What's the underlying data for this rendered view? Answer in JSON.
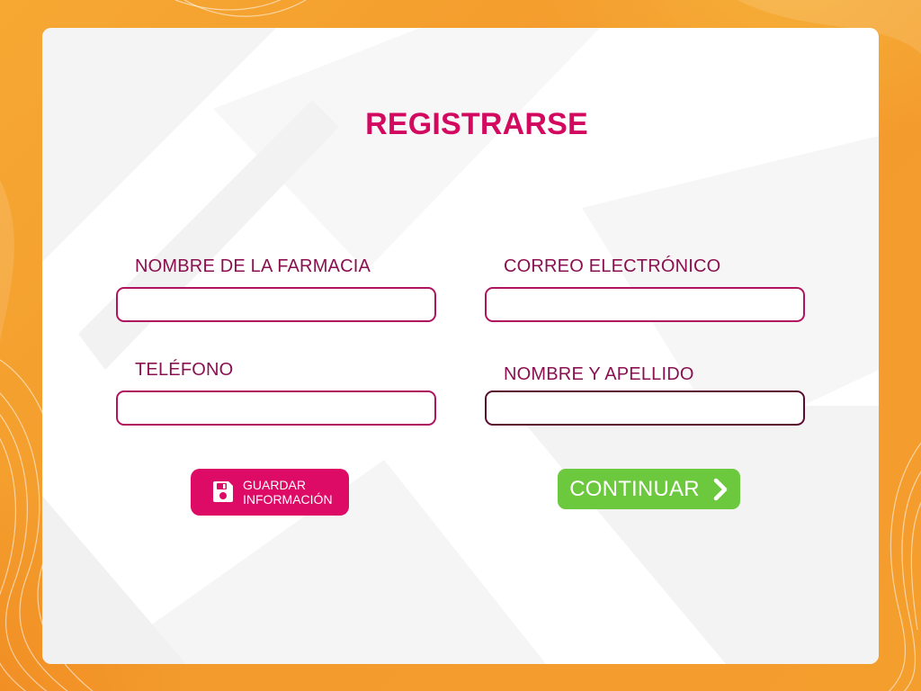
{
  "page": {
    "title": "REGISTRARSE"
  },
  "form": {
    "pharmacy_name": {
      "label": "NOMBRE DE LA FARMACIA",
      "value": ""
    },
    "email": {
      "label": "CORREO ELECTRÓNICO",
      "value": ""
    },
    "phone": {
      "label": "TELÉFONO",
      "value": ""
    },
    "full_name": {
      "label": "NOMBRE Y APELLIDO",
      "value": ""
    }
  },
  "buttons": {
    "save": {
      "line1": "GUARDAR",
      "line2": "INFORMACIÓN",
      "icon": "floppy-disk-icon"
    },
    "continue": {
      "label": "CONTINUAR",
      "icon": "chevron-right-icon"
    }
  },
  "colors": {
    "background": "#f39a2c",
    "title": "#d3095f",
    "label": "#8a1050",
    "input_border": "#b0145f",
    "save_button": "#dd0a66",
    "continue_button": "#6cc83d"
  }
}
